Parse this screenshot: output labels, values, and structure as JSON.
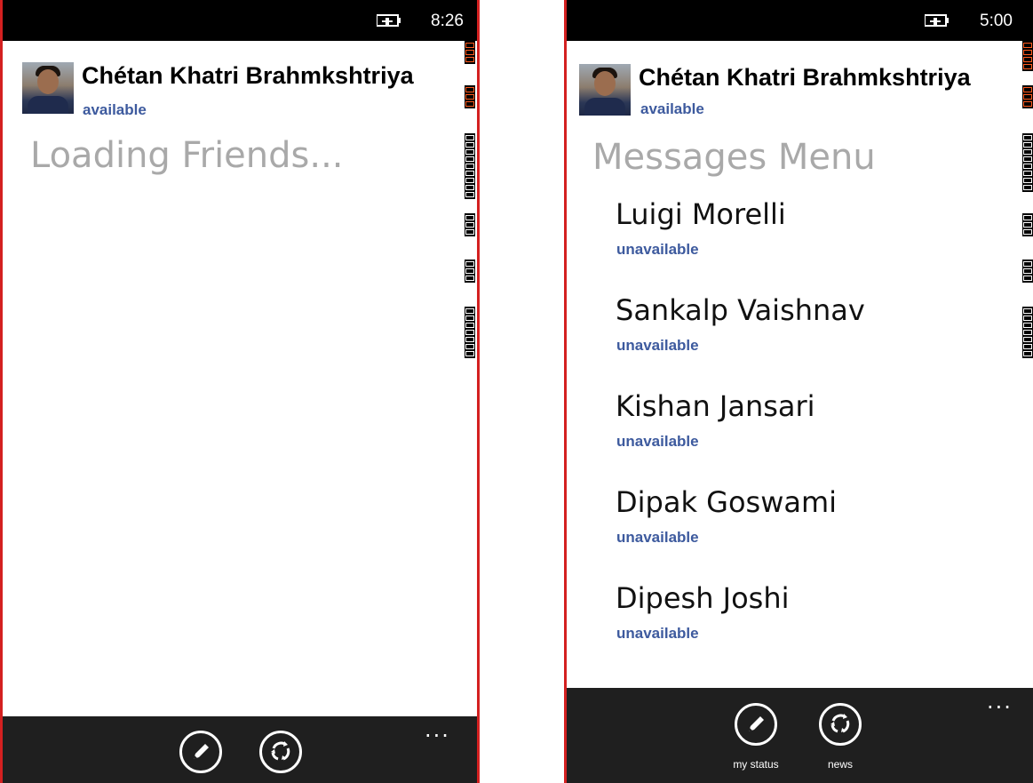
{
  "left": {
    "system": {
      "time": "8:26"
    },
    "profile": {
      "name": "Chétan Khatri Brahmkshtriya",
      "status": "available"
    },
    "page_title": "Loading Friends..."
  },
  "right": {
    "system": {
      "time": "5:00"
    },
    "profile": {
      "name": "Chétan Khatri Brahmkshtriya",
      "status": "available"
    },
    "page_title": "Messages Menu",
    "friends": [
      {
        "name": "Luigi Morelli",
        "status": "unavailable"
      },
      {
        "name": "Sankalp Vaishnav",
        "status": "unavailable"
      },
      {
        "name": "Kishan Jansari",
        "status": "unavailable"
      },
      {
        "name": "Dipak Goswami",
        "status": "unavailable"
      },
      {
        "name": "Dipesh Joshi",
        "status": "unavailable"
      }
    ],
    "appbar": {
      "my_status_label": "my status",
      "news_label": "news",
      "more": "..."
    }
  },
  "icons": {
    "battery": "battery-charging-icon",
    "edit": "pencil-icon",
    "news": "refresh-circle-icon",
    "more": "ellipsis-icon"
  },
  "colors": {
    "accent": "#3d5a9e",
    "frame": "#d42020",
    "appbar": "#1f1f1f"
  }
}
